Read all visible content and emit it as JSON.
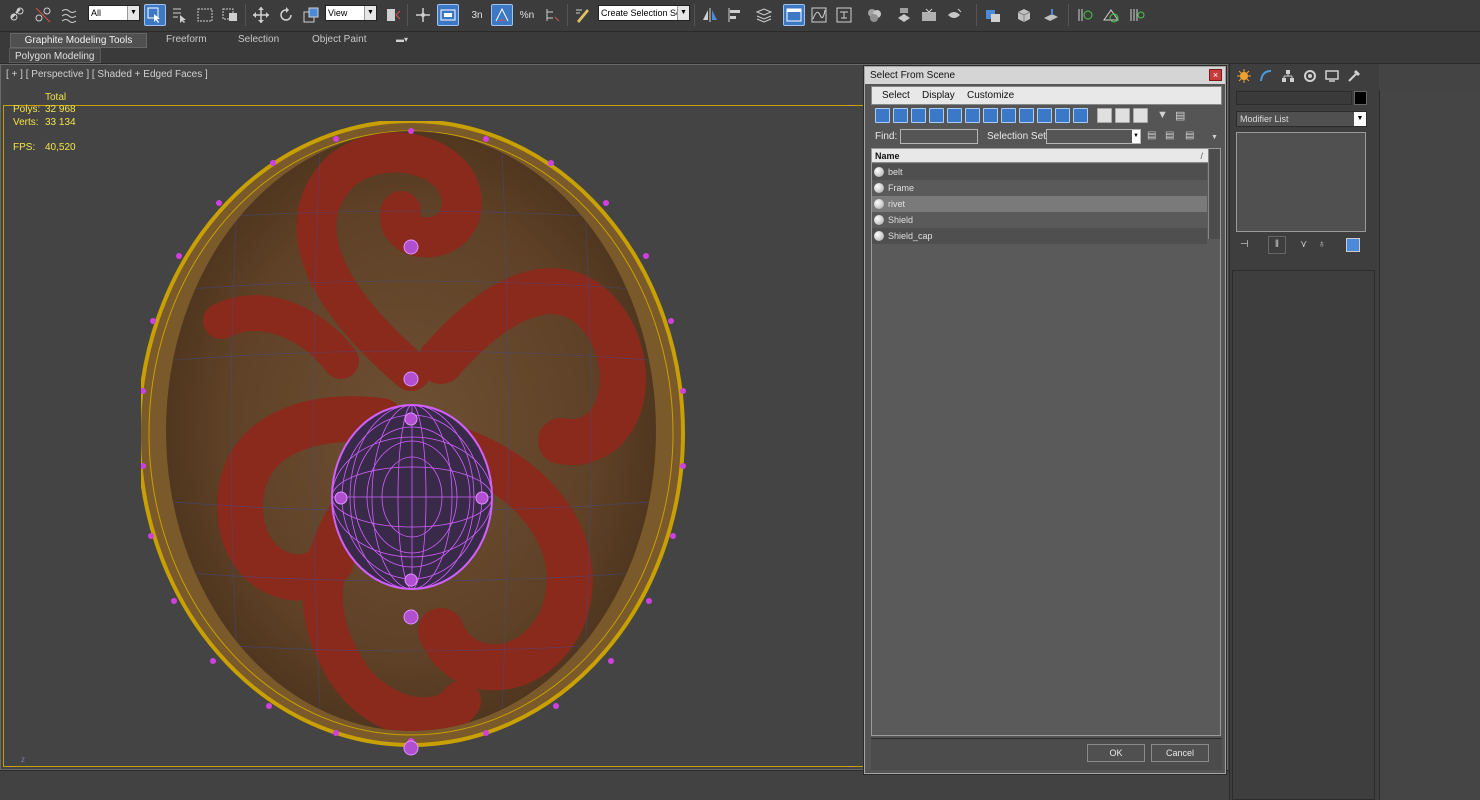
{
  "toolbar": {
    "selection_filter": "All",
    "reference_coordinate": "View",
    "named_selection_placeholder": "Create Selection Se",
    "snap_angle_label": "3n",
    "percent_snap_label": "%n",
    "spinner_snap_label": "n"
  },
  "ribbon": {
    "tabs": [
      "Graphite Modeling Tools",
      "Freeform",
      "Selection",
      "Object Paint"
    ],
    "panel_label": "Polygon Modeling"
  },
  "viewport": {
    "label": "[ + ] [ Perspective ] [ Shaded + Edged Faces ]",
    "stats": {
      "total_label": "Total",
      "polys_label": "Polys:",
      "polys_value": "32 968",
      "verts_label": "Verts:",
      "verts_value": "33 134",
      "fps_label": "FPS:",
      "fps_value": "40,520"
    },
    "axis_label": "z"
  },
  "command_panel": {
    "modifier_list_label": "Modifier List"
  },
  "dialog": {
    "title": "Select From Scene",
    "close_glyph": "×",
    "menu": [
      "Select",
      "Display",
      "Customize"
    ],
    "find_label": "Find:",
    "selection_set_label": "Selection Set:",
    "column_name": "Name",
    "sort_glyph": "/",
    "objects": [
      {
        "name": "belt",
        "selected": false
      },
      {
        "name": "Frame",
        "selected": false
      },
      {
        "name": "rivet",
        "selected": true
      },
      {
        "name": "Shield",
        "selected": false
      },
      {
        "name": "Shield_cap",
        "selected": false
      }
    ],
    "ok_label": "OK",
    "cancel_label": "Cancel"
  },
  "colors": {
    "accent_blue": "#3d78c4",
    "stats_yellow": "#f2e34a",
    "selection_wire": "#d060ff",
    "frame_wire": "#c8a000",
    "shield_wood": "#6b4a2a",
    "shield_paint": "#8a2a1c"
  }
}
